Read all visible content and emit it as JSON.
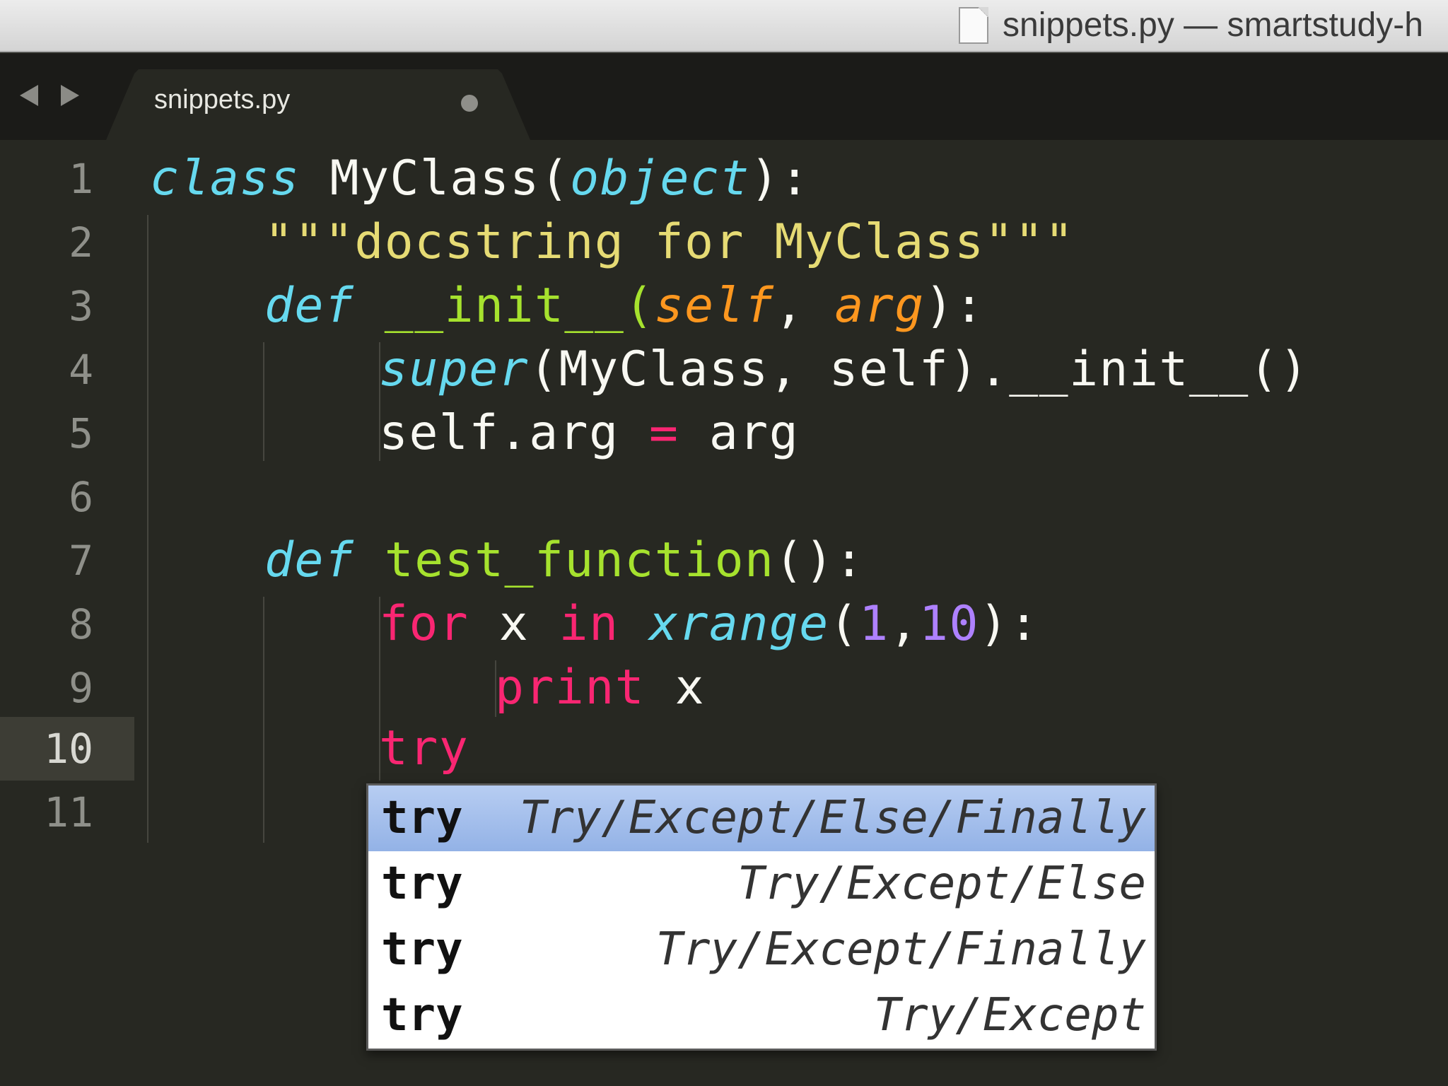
{
  "window": {
    "title": "snippets.py — smartstudy-h"
  },
  "tabs": [
    {
      "label": "snippets.py",
      "modified": true
    }
  ],
  "gutter": {
    "line_numbers": [
      "1",
      "2",
      "3",
      "4",
      "5",
      "6",
      "7",
      "8",
      "9",
      "10",
      "11"
    ],
    "current_line": "10"
  },
  "code": {
    "l1": {
      "kw": "class",
      "name": " MyClass(",
      "base": "object",
      "end": "):"
    },
    "l2": {
      "docstring": "\"\"\"docstring for MyClass\"\"\""
    },
    "l3": {
      "kw": "def",
      "name": " __init__(",
      "p1": "self",
      "sep": ", ",
      "p2": "arg",
      "end": "):"
    },
    "l4": {
      "builtin": "super",
      "rest": "(MyClass, self).__init__()"
    },
    "l5": {
      "a": "self.arg ",
      "op": "=",
      "b": " arg"
    },
    "l7": {
      "kw": "def",
      "name": "test_function",
      "end": "():"
    },
    "l8": {
      "kw": "for",
      "var": " x ",
      "kw2": "in",
      "sp": " ",
      "builtin": "xrange",
      "open": "(",
      "n1": "1",
      "comma": ",",
      "n2": "10",
      "end": "):"
    },
    "l9": {
      "kw": "print",
      "rest": " x"
    },
    "l10": {
      "kw": "try"
    }
  },
  "autocomplete": {
    "items": [
      {
        "trigger": "try",
        "description": "Try/Except/Else/Finally",
        "selected": true
      },
      {
        "trigger": "try",
        "description": "Try/Except/Else",
        "selected": false
      },
      {
        "trigger": "try",
        "description": "Try/Except/Finally",
        "selected": false
      },
      {
        "trigger": "try",
        "description": "Try/Except",
        "selected": false
      }
    ]
  },
  "theme": {
    "background": "#272822",
    "keyword": "#f92672",
    "storage": "#66d9ef",
    "function": "#a6e22e",
    "string": "#e6db74",
    "parameter": "#fd971f",
    "number": "#ae81ff",
    "selection_popup": "#a3bfee"
  }
}
